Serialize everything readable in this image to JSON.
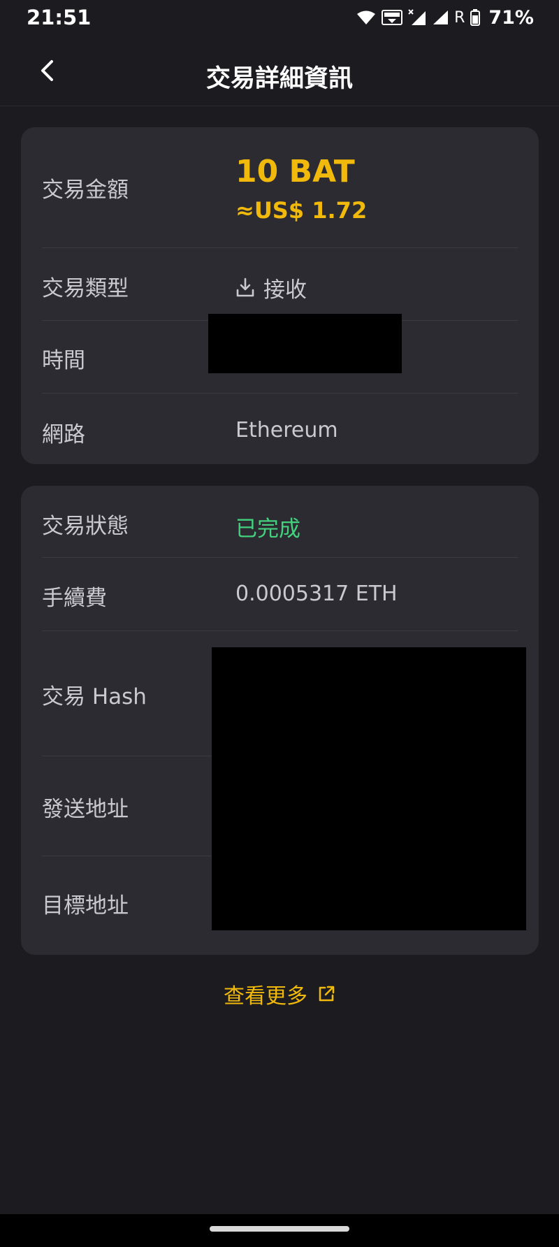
{
  "status_bar": {
    "time": "21:51",
    "r_label": "R",
    "battery": "71%"
  },
  "header": {
    "title": "交易詳細資訊"
  },
  "details": {
    "amount_label": "交易金額",
    "amount_value": "10 BAT",
    "amount_usd": "≈US$ 1.72",
    "type_label": "交易類型",
    "type_value": "接收",
    "time_label": "時間",
    "network_label": "網路",
    "network_value": "Ethereum"
  },
  "status_card": {
    "status_label": "交易狀態",
    "status_value": "已完成",
    "fee_label": "手續費",
    "fee_value": "0.0005317 ETH",
    "hash_label": "交易 Hash",
    "from_label": "發送地址",
    "to_label": "目標地址"
  },
  "footer": {
    "view_more": "查看更多"
  },
  "colors": {
    "accent": "#f0b90b",
    "success": "#43d17e",
    "background": "#1b1b20",
    "card": "#2b2b31"
  },
  "icons": {
    "back": "chevron-left-icon",
    "receive": "download-icon",
    "external": "external-link-icon"
  }
}
